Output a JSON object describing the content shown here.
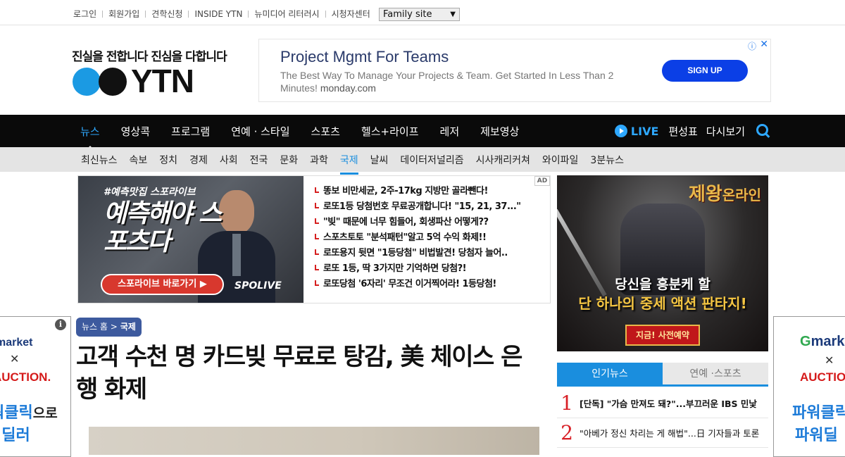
{
  "util": {
    "links": [
      "로그인",
      "회원가입",
      "견학신청",
      "INSIDE YTN",
      "뉴미디어 리터러시",
      "시청자센터"
    ],
    "family_site": "Family site"
  },
  "logo": {
    "slogan": "진실을 전합니다  진심을 다합니다",
    "text": "YTN"
  },
  "header_ad": {
    "title": "Project Mgmt For Teams",
    "desc": "The Best Way To Manage Your Projects & Team. Get Started In Less Than 2 Minutes!",
    "domain": "monday.com",
    "button": "SIGN UP",
    "info_icon": "ⓘ",
    "close_icon": "✕"
  },
  "gnb": {
    "items": [
      "뉴스",
      "영상콕",
      "프로그램",
      "연예 · 스타일",
      "스포츠",
      "헬스+라이프",
      "레저",
      "제보영상"
    ],
    "live": "LIVE",
    "schedule": "편성표",
    "replay": "다시보기"
  },
  "lnb": {
    "items": [
      "최신뉴스",
      "속보",
      "정치",
      "경제",
      "사회",
      "전국",
      "문화",
      "과학",
      "국제",
      "날씨",
      "데이터저널리즘",
      "시사캐리커쳐",
      "와이파일",
      "3분뉴스"
    ]
  },
  "promo": {
    "badge": "AD",
    "tag": "#예측맛집 스포라이브",
    "headline": "예측해야 스포츠다",
    "cta": "스포라이브 바로가기 ▶",
    "brand": "SPOLIVE",
    "links": [
      "똥보 비만세균, 2주-17kg 지방만 골라뺀다!",
      "로또1등 당첨번호 무료공개합니다! \"15, 21, 37...\"",
      "\"빚\" 때문에 너무 힘들어, 회생파산 어떻게??",
      "스포츠토토 \"분석패턴\"알고 5억 수익 화제!!",
      "로또용지 뒷면 \"1등당첨\" 비법발견! 당첨자 늘어..",
      "로또 1등, 딱 3가지만 기억하면 당첨?!",
      "로또당첨 '6자리' 무조건 이거찍어라! 1등당첨!"
    ]
  },
  "game_ad": {
    "title": "제왕",
    "title_sub": "온라인",
    "copy1": "당신을 흥분케 할",
    "copy2": "단 하나의 중세 액션 판타지!",
    "button": "지금! 사전예약"
  },
  "side_banner_left": {
    "info": "i",
    "brand1": "market",
    "close": "✕",
    "brand2": "AUCTION.",
    "promo1": "워클릭",
    "promo1_suffix": "으로",
    "promo2": "워딜러"
  },
  "side_banner_right": {
    "brand1_g": "G",
    "brand1": "market",
    "close": "✕",
    "brand2": "AUCTION",
    "promo1": "파워클릭",
    "promo2": "파워딜"
  },
  "article": {
    "breadcrumb_home": "뉴스 홈 >",
    "breadcrumb_current": "국제",
    "headline": "고객 수천 명 카드빚 무료로 탕감, 美 체이스 은행 화제"
  },
  "popular": {
    "tab_active": "인기뉴스",
    "tab_inactive": "연예 ·스포츠",
    "items": [
      {
        "rank": "1",
        "text": "[단독] \"가슴 만져도 돼?\"...부끄러운 IBS 민낯"
      },
      {
        "rank": "2",
        "text": "\"아베가 정신 차리는 게 해법\"...日 기자들과 토론"
      }
    ]
  },
  "colors": {
    "accent": "#1a8ede",
    "gnb_bg": "#0a0a0a",
    "live": "#2ea8ff",
    "rank": "#d81f26",
    "breadcrumb_bg": "#3d5a9e"
  }
}
